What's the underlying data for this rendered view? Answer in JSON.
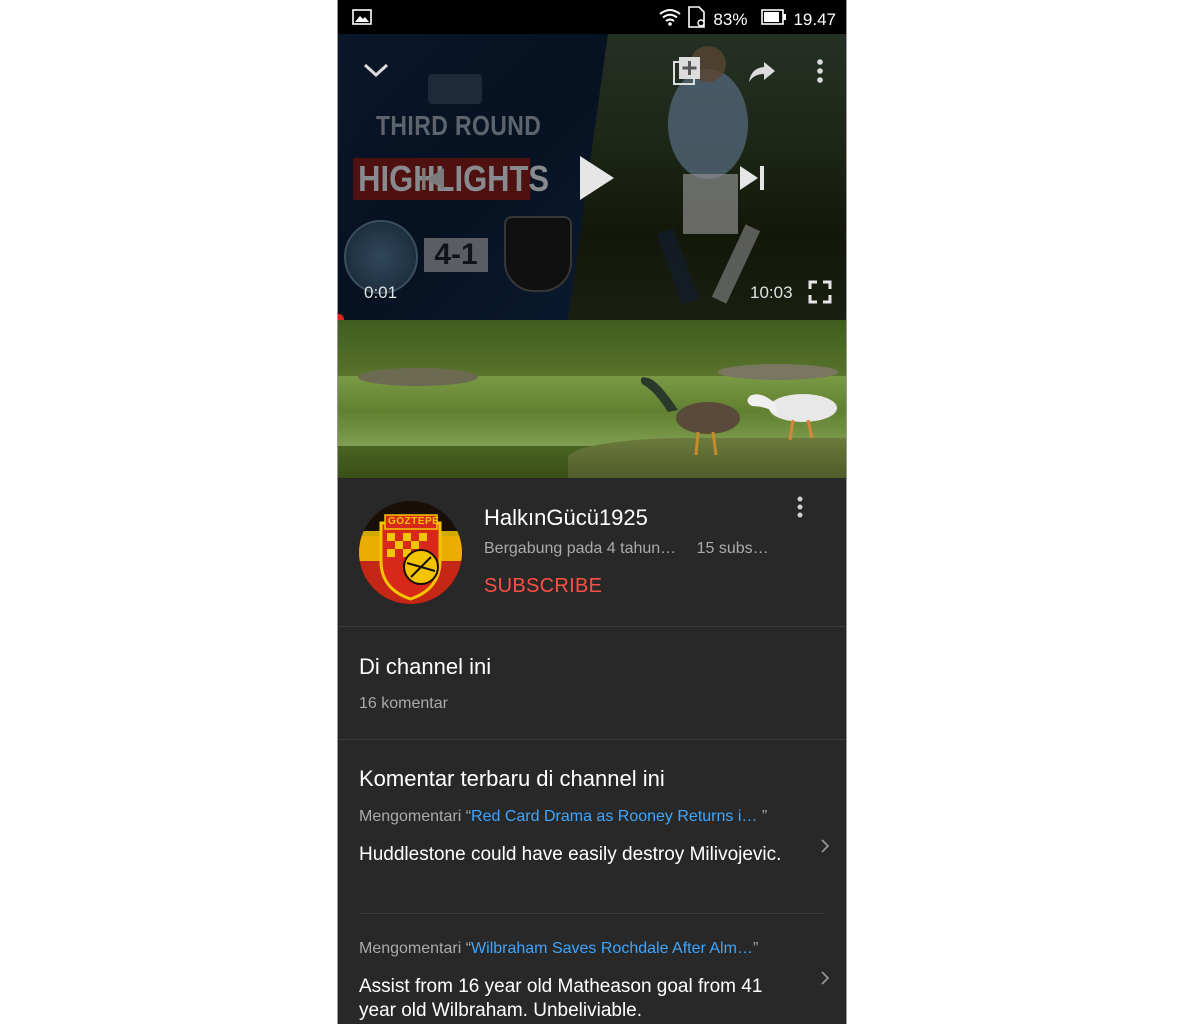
{
  "status_bar": {
    "battery_percent": "83%",
    "time": "19.47",
    "icons": [
      "gallery-icon",
      "wifi-icon",
      "sim-icon",
      "battery-icon"
    ]
  },
  "player": {
    "thumbnail_title_line1": "THIRD ROUND",
    "thumbnail_title_line2": "HIGHLIGHTS",
    "thumbnail_score": "4-1",
    "current_time": "0:01",
    "duration": "10:03",
    "progress_fraction": 0.002
  },
  "channel": {
    "name": "HalkınGücü1925",
    "joined": "Bergabung pada 4 tahun…",
    "subscribers": "15 subs…",
    "subscribe_label": "SUBSCRIBE",
    "avatar_text": "GÖZTEPE"
  },
  "on_channel": {
    "title": "Di channel ini",
    "count": "16 komentar"
  },
  "recent_comments": {
    "title": "Komentar terbaru di channel ini",
    "items": [
      {
        "prefix": "Mengomentari “",
        "video": "Red Card Drama as Rooney Returns i…",
        "suffix": " ”",
        "text": "Huddlestone could have easily destroy Milivojevic."
      },
      {
        "prefix": "Mengomentari “",
        "video": "Wilbraham Saves Rochdale After Alm…",
        "suffix": "”",
        "text": "Assist from 16 year old Matheason goal from 41 year old Wilbraham. Unbeliviable."
      }
    ]
  },
  "colors": {
    "background": "#282828",
    "subscribe": "#ff4e45",
    "link": "#3ea6ff",
    "secondary_text": "#aaaaaa"
  }
}
